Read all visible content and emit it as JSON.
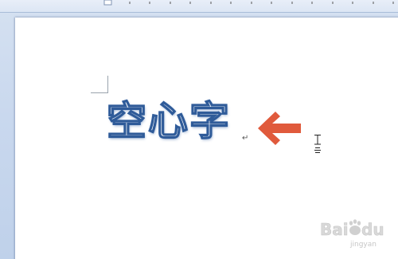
{
  "document": {
    "hollow_text": "空心字",
    "paragraph_mark": "↵"
  },
  "annotation": {
    "arrow_color": "#e05a3c",
    "arrow_direction": "left"
  },
  "cursor": {
    "type": "i-beam-icon"
  },
  "watermark": {
    "logo_text": "Bai du",
    "sub_text": "jingyan"
  },
  "colors": {
    "text_outline": "#2f5b99",
    "workspace_bg": "#c9d8ee",
    "page_bg": "#ffffff"
  }
}
